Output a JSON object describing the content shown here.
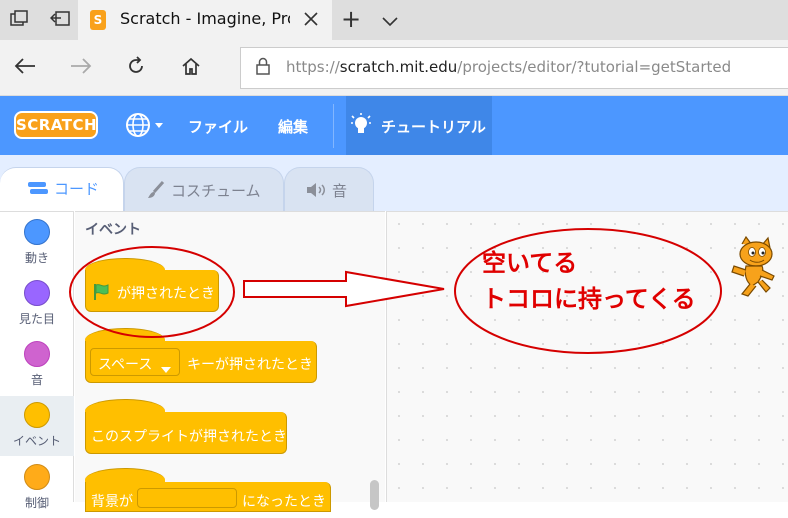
{
  "browser": {
    "tab_title": "Scratch - Imagine, Progr",
    "new_tab": "+",
    "url_prefix": "https://",
    "url_host": "scratch.mit.edu",
    "url_path": "/projects/editor/?tutorial=getStarted"
  },
  "menubar": {
    "logo": "SCRATCH",
    "file": "ファイル",
    "edit": "編集",
    "tutorial": "チュートリアル"
  },
  "editor_tabs": {
    "code": "コード",
    "costumes": "コスチューム",
    "sounds": "音"
  },
  "categories": [
    {
      "label": "動き",
      "color": "#4c97ff"
    },
    {
      "label": "見た目",
      "color": "#9966ff"
    },
    {
      "label": "音",
      "color": "#cf63cf"
    },
    {
      "label": "イベント",
      "color": "#ffbf00"
    },
    {
      "label": "制御",
      "color": "#ffab19"
    }
  ],
  "palette": {
    "heading": "イベント",
    "blocks": {
      "flag_clicked": "が押されたとき",
      "key_dropdown": "スペース",
      "key_pressed": "キーが押されたとき",
      "sprite_clicked": "このスプライトが押されたとき",
      "backdrop_prefix": "背景が",
      "backdrop_suffix": "になったとき"
    }
  },
  "annotation": {
    "text": "空いてる\nトコロに持ってくる",
    "color": "#e00000"
  }
}
